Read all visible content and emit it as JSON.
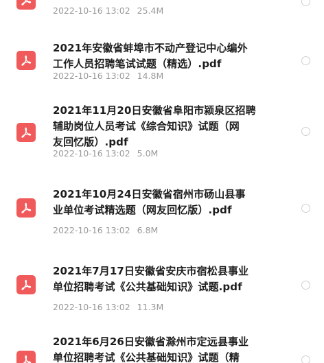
{
  "files": [
    {
      "title": "",
      "date": "2022-10-16 13:02",
      "size": "25.4M",
      "icon": "pdf-icon"
    },
    {
      "title": "2021年安徽省蚌埠市不动产登记中心编外\n工作人员招聘笔试试题（精选）.pdf",
      "date": "2022-10-16 13:02",
      "size": "14.8M",
      "icon": "pdf-icon"
    },
    {
      "title": "2021年11月20日安徽省阜阳市颍泉区招聘\n辅助岗位人员考试《综合知识》试题（网\n友回忆版）.pdf",
      "date": "2022-10-16 13:02",
      "size": "5.0M",
      "icon": "pdf-icon"
    },
    {
      "title": "2021年10月24日安徽省宿州市砀山县事\n业单位考试精选题（网友回忆版）.pdf",
      "date": "2022-10-16 13:02",
      "size": "6.8M",
      "icon": "pdf-icon"
    },
    {
      "title": "2021年7月17日安徽省安庆市宿松县事业\n单位招聘考试《公共基础知识》试题.pdf",
      "date": "2022-10-16 13:02",
      "size": "11.3M",
      "icon": "pdf-icon"
    },
    {
      "title": "2021年6月26日安徽省滁州市定远县事业\n单位招聘考试《公共基础知识》试题（精",
      "date": "",
      "size": "",
      "icon": "pdf-icon"
    }
  ],
  "colors": {
    "pdf_icon": "#f05a5a",
    "title": "#1d1d1d",
    "meta": "#9a9a9a",
    "radio_border": "#cfcfcf"
  }
}
